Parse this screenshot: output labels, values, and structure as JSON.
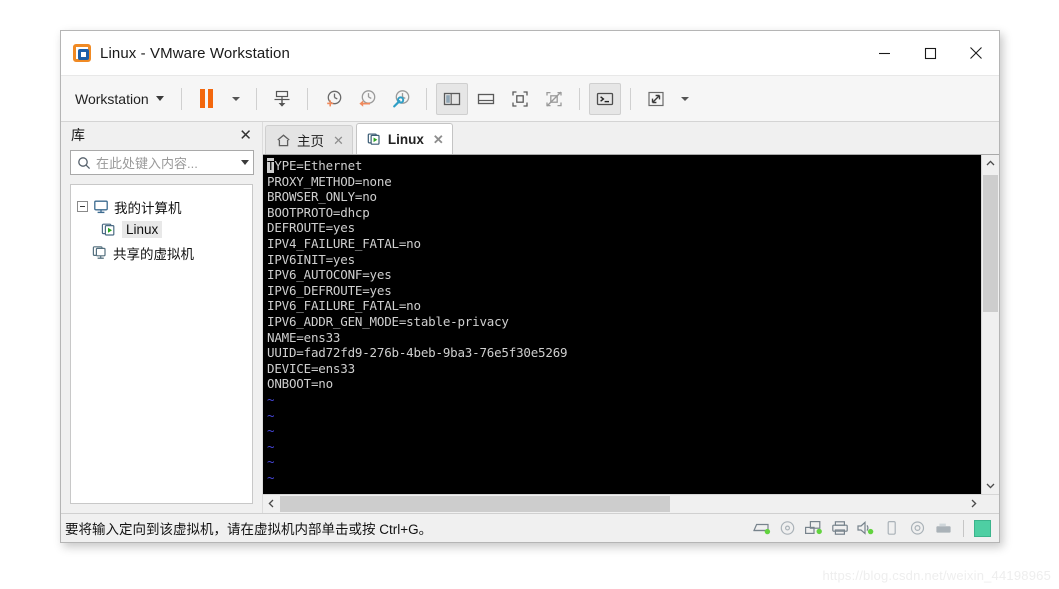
{
  "window": {
    "title": "Linux - VMware Workstation",
    "logo_icon": "vmware-logo-icon",
    "controls": {
      "minimize": "minimize-icon",
      "maximize": "maximize-icon",
      "close": "close-icon"
    }
  },
  "toolbar": {
    "menu_label": "Workstation",
    "menu_caret": "chevron-down-icon",
    "buttons": [
      {
        "name": "suspend-vm-button",
        "icon": "pause-icon"
      },
      {
        "name": "power-dropdown-button",
        "icon": "chevron-down-icon"
      },
      {
        "name": "send-ctrl-alt-del-button",
        "icon": "send-keystroke-icon"
      },
      {
        "name": "take-snapshot-button",
        "icon": "snapshot-add-icon"
      },
      {
        "name": "revert-snapshot-button",
        "icon": "snapshot-revert-icon"
      },
      {
        "name": "manage-snapshots-button",
        "icon": "snapshot-manage-icon"
      },
      {
        "name": "show-library-button",
        "icon": "library-panel-icon"
      },
      {
        "name": "show-thumbnail-bar-button",
        "icon": "thumbnail-bar-icon"
      },
      {
        "name": "fullscreen-button",
        "icon": "fullscreen-icon"
      },
      {
        "name": "unity-mode-button",
        "icon": "unity-mode-icon"
      },
      {
        "name": "console-view-button",
        "icon": "console-icon"
      },
      {
        "name": "stretch-guest-button",
        "icon": "expand-arrows-icon"
      },
      {
        "name": "stretch-dropdown-button",
        "icon": "chevron-down-icon"
      }
    ]
  },
  "sidebar": {
    "header_title": "库",
    "close_icon": "close-icon",
    "search": {
      "icon": "search-icon",
      "placeholder": "在此处键入内容...",
      "value": "",
      "dropdown_icon": "chevron-down-icon"
    },
    "tree": [
      {
        "label": "我的计算机",
        "icon": "computer-icon",
        "expanded": true,
        "selected": false
      },
      {
        "label": "Linux",
        "icon": "virtual-machine-running-icon",
        "selected": true
      },
      {
        "label": "共享的虚拟机",
        "icon": "shared-vms-icon",
        "selected": false
      }
    ]
  },
  "tabs": [
    {
      "label": "主页",
      "icon": "home-icon",
      "active": false,
      "close_icon": "close-icon"
    },
    {
      "label": "Linux",
      "icon": "virtual-machine-running-icon",
      "active": true,
      "close_icon": "close-icon"
    }
  ],
  "terminal": {
    "cursor_char": "T",
    "lines": [
      "YPE=Ethernet",
      "PROXY_METHOD=none",
      "BROWSER_ONLY=no",
      "BOOTPROTO=dhcp",
      "DEFROUTE=yes",
      "IPV4_FAILURE_FATAL=no",
      "IPV6INIT=yes",
      "IPV6_AUTOCONF=yes",
      "IPV6_DEFROUTE=yes",
      "IPV6_FAILURE_FATAL=no",
      "IPV6_ADDR_GEN_MODE=stable-privacy",
      "NAME=ens33",
      "UUID=fad72fd9-276b-4beb-9ba3-76e5f30e5269",
      "DEVICE=ens33",
      "ONBOOT=no"
    ],
    "empty_line_marker": "~",
    "empty_line_count": 6
  },
  "scrollbars": {
    "vertical": {
      "up_icon": "chevron-up-icon",
      "down_icon": "chevron-down-icon",
      "thumb_top_pct": 1,
      "thumb_height_pct": 45
    },
    "horizontal": {
      "left_icon": "chevron-left-icon",
      "right_icon": "chevron-right-icon",
      "thumb_left_pct": 0,
      "thumb_width_pct": 57
    }
  },
  "statusbar": {
    "message": "要将输入定向到该虚拟机，请在虚拟机内部单击或按 Ctrl+G。",
    "devices": [
      {
        "name": "hard-disk-icon",
        "connected": true
      },
      {
        "name": "cd-dvd-icon",
        "connected": false
      },
      {
        "name": "network-adapter-icon",
        "connected": true
      },
      {
        "name": "printer-icon",
        "connected": false
      },
      {
        "name": "sound-card-icon",
        "connected": true
      },
      {
        "name": "usb-device-icon",
        "connected": false
      },
      {
        "name": "floppy-icon",
        "connected": false
      },
      {
        "name": "usb-drive-icon",
        "connected": false
      }
    ],
    "indicator": {
      "name": "vm-message-indicator",
      "color": "#4ecfa3"
    }
  },
  "watermark": "https://blog.csdn.net/weixin_44198965",
  "colors": {
    "accent_orange": "#f3670d",
    "accent_blue": "#1d5fa8",
    "terminal_bg": "#000000",
    "terminal_fg": "#cfcfcf",
    "vim_tilde": "#4646d8",
    "indicator_green": "#4ecfa3"
  }
}
